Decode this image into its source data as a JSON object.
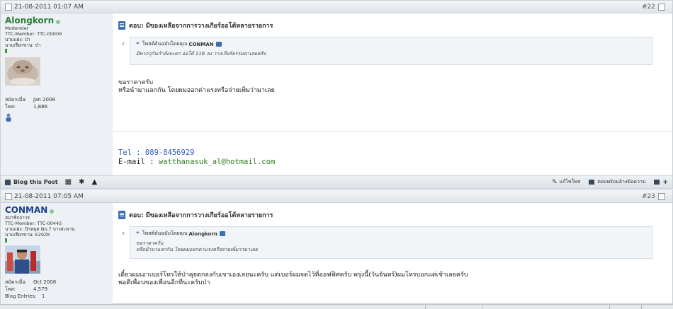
{
  "post1": {
    "date": "21-08-2011 01:07 AM",
    "number": "#22",
    "user": {
      "name": "Alongkorn",
      "lines": [
        "Modereter",
        "TTC-Member: TTC-00009",
        "นามแฝง: ป่า",
        "นามเรียกขาน: ป่า"
      ],
      "joined_label": "สมัครเมื่อ:",
      "joined_value": "Jan 2008",
      "posts_label": "โพส:",
      "posts_value": "1,886"
    },
    "title": "ตอบ: มีของเหลือจากการวางเกียร์ออโต้หลายรายการ",
    "quote": {
      "prefix": "โพสต์ต้นฉบับโดยคุณ",
      "author": "CONMAN",
      "body": [
        "มีพวกกุกันกำลังจะยก ออโต้ 116 ลง วางเกียร์ธรรมดาเลยครับ"
      ]
    },
    "message": [
      "ขอราคาครับ",
      "หรือนำมาแลกกัน โดยผมออกค่าแรงหรือจ่ายเพิ่มว่ามาเลย"
    ],
    "signature": {
      "tel": "Tel : 089-8456929",
      "email_label": "E-mail : ",
      "email": "watthanasuk_al@hotmail.com"
    },
    "footer": {
      "blog": "Blog this Post",
      "edit": "แก้ไขโพส",
      "reply_quote": "ตอบพร้อมอ้างข้อความ"
    }
  },
  "post2": {
    "date": "21-08-2011 07:05 AM",
    "number": "#23",
    "user": {
      "name": "CONMAN",
      "lines": [
        "สมาชิกถาวร",
        "TTC-Member: TTC-00445",
        "นามแฝง: ปักหมุด No.7 บางสะพาน",
        "นามเรียกขาน: E29ZK"
      ],
      "joined_label": "สมัครเมื่อ:",
      "joined_value": "Oct 2008",
      "posts_label": "โพส:",
      "posts_value": "4,579",
      "blog_label": "Blog Entries:",
      "blog_value": "1"
    },
    "title": "ตอบ: มีของเหลือจากการวางเกียร์ออโต้หลายรายการ",
    "quote": {
      "prefix": "โพสต์ต้นฉบับโดยคุณ",
      "author": "Alongkorn",
      "body": [
        "ขอราคาครับ",
        "หรือนำมาแลกกัน โดยผมออกค่าแรงหรือจ่ายเพิ่มว่ามาเลย"
      ]
    },
    "message": [
      "เดี๋ยวผมเอาเบอร์โทรให้ป่าคุยตกลงกับเขาเองเลยนะครับ แต่เบอร์ผมจดไว้ที่ออฟฟิศครับ พรุ่งนี้(วันจันทร์)ผมโทรบอกแต่เช้าเลยครับ",
      "พอดีเพื่อนของเพื่อนอีกทีน่ะครับป่า"
    ]
  },
  "colors": {
    "username": "#2a7f39",
    "accent": "#3b6eb3",
    "email": "#2e7d1e",
    "tel": "#2f5eb8"
  }
}
